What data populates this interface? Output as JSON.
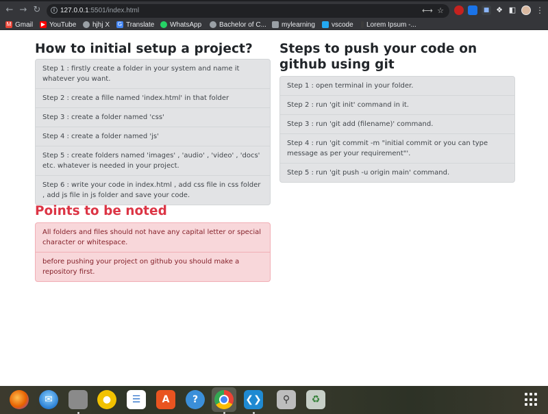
{
  "browser": {
    "url_host": "127.0.0.1",
    "url_rest": ":5501/index.html",
    "bookmarks": [
      {
        "label": "Gmail",
        "icon": "gmail-icon",
        "color": "#ea4335"
      },
      {
        "label": "YouTube",
        "icon": "youtube-icon",
        "color": "#ff0000"
      },
      {
        "label": "hjhj X",
        "icon": "globe-icon",
        "color": "#9aa0a6"
      },
      {
        "label": "Translate",
        "icon": "translate-icon",
        "color": "#4285f4"
      },
      {
        "label": "WhatsApp",
        "icon": "whatsapp-icon",
        "color": "#25d366"
      },
      {
        "label": "Bachelor of C...",
        "icon": "globe-icon",
        "color": "#9aa0a6"
      },
      {
        "label": "mylearning",
        "icon": "folder-icon",
        "color": "#9aa0a6"
      },
      {
        "label": "vscode",
        "icon": "vscode-icon",
        "color": "#23a9f2"
      },
      {
        "label": "Lorem Ipsum -...",
        "icon": "page-icon",
        "color": "#3c3c3c"
      }
    ]
  },
  "page": {
    "setup_title": "How to initial setup a project?",
    "setup_steps": [
      "Step 1 : firstly create a folder in your system and name it whatever you want.",
      "Step 2 : create a fille named 'index.html' in that folder",
      "Step 3 : create a folder named 'css'",
      "Step 4 : create a folder named 'js'",
      "Step 5 : create folders named 'images' , 'audio' , 'video' , 'docs' etc. whatever is needed in your project.",
      "Step 6 : write your code in index.html , add css file in css folder , add js file in js folder and save your code."
    ],
    "notes_title": "Points to be noted",
    "notes": [
      "All folders and files should not have any capital letter or special character or whitespace.",
      "before pushing your project on github you should make a repository first."
    ],
    "git_title": "Steps to push your code on github using git",
    "git_steps": [
      "Step 1 : open terminal in your folder.",
      "Step 2 : run 'git init' command in it.",
      "Step 3 : run 'git add (filename)' command.",
      "Step 4 : run 'git commit -m \"initial commit or you can type message as per your requirement\"'.",
      "Step 5 : run 'git push -u origin main' command."
    ]
  },
  "taskbar": {
    "apps": [
      {
        "icon": "firefox-icon",
        "color": "#e66000"
      },
      {
        "icon": "thunderbird-icon",
        "color": "#2a7fd4"
      },
      {
        "icon": "files-icon",
        "color": "#8a8a8a"
      },
      {
        "icon": "rhythmbox-icon",
        "color": "#f2c200"
      },
      {
        "icon": "libreoffice-writer-icon",
        "color": "#2a6fc9"
      },
      {
        "icon": "software-center-icon",
        "color": "#e95420"
      },
      {
        "icon": "help-icon",
        "color": "#3b8fd9"
      },
      {
        "icon": "chrome-icon",
        "color": "#ea4335"
      },
      {
        "icon": "vscode-icon",
        "color": "#1f8ad2"
      },
      {
        "icon": "screenshot-icon",
        "color": "#7d7d7d"
      },
      {
        "icon": "trash-icon",
        "color": "#9aa39a"
      }
    ]
  }
}
